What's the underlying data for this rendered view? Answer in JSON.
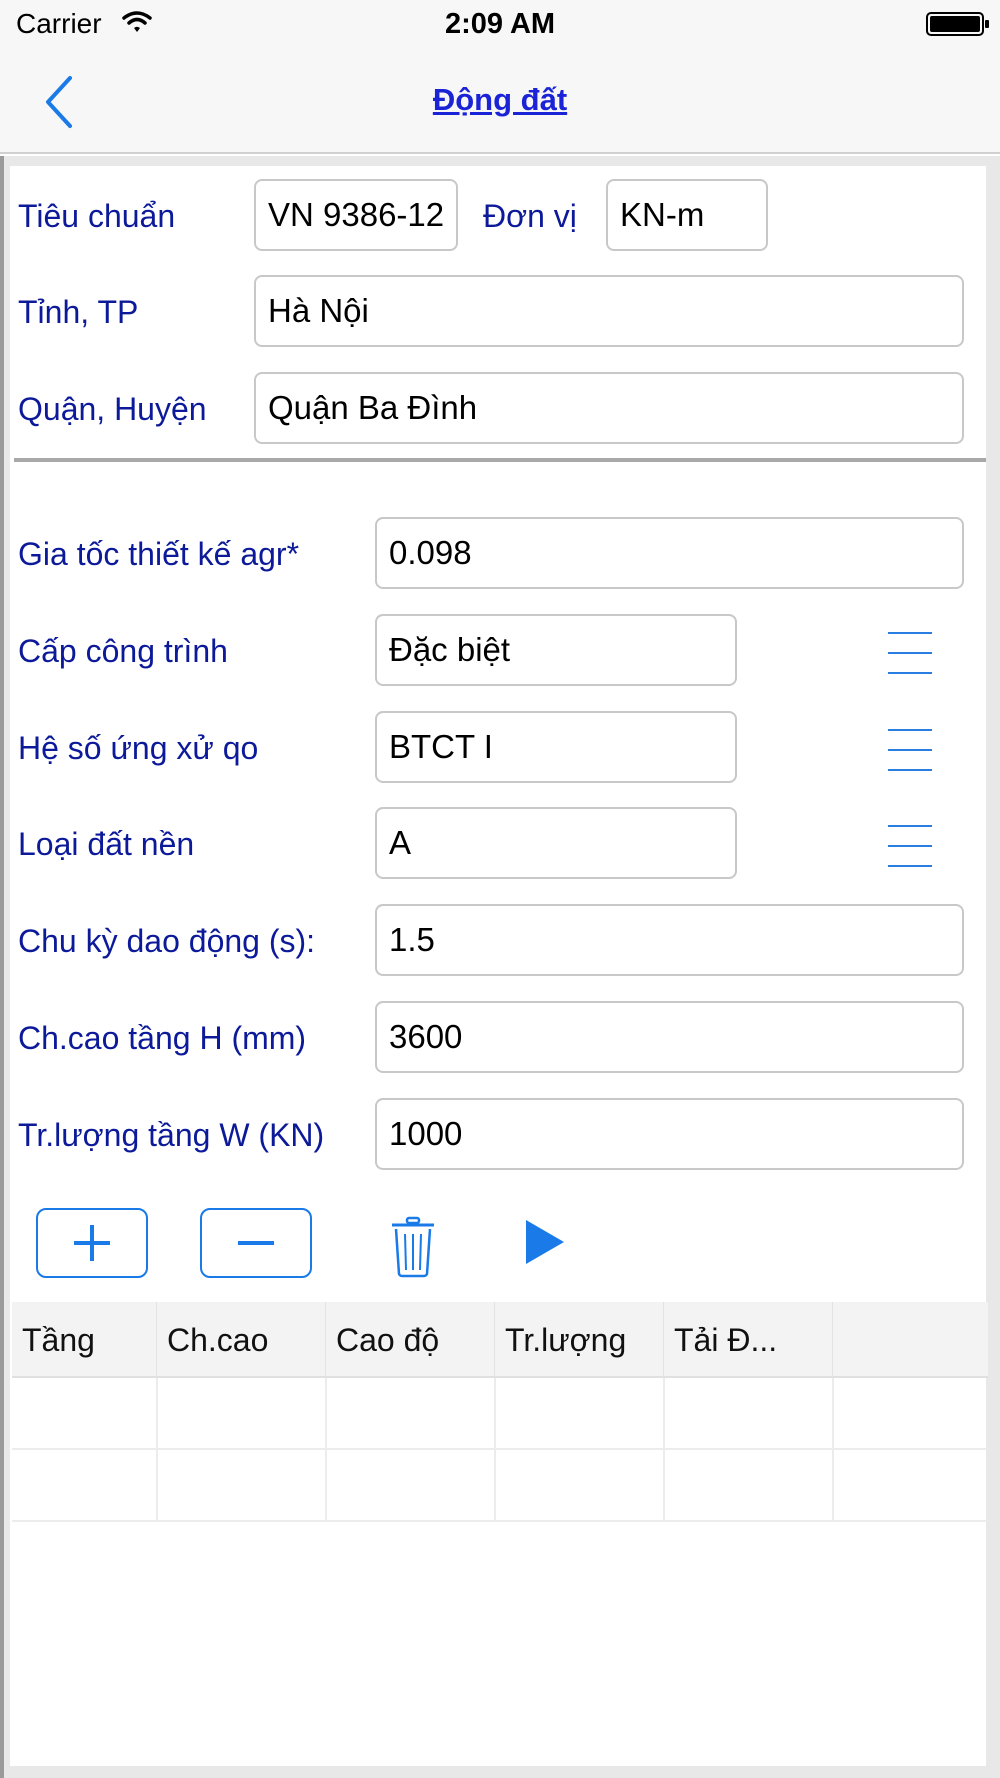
{
  "status_bar": {
    "carrier": "Carrier",
    "time": "2:09 AM"
  },
  "nav": {
    "title": "Động đất",
    "back_icon": "chevron-left-icon"
  },
  "header_form": {
    "standard_label": "Tiêu chuẩn",
    "standard_value": "VN 9386-12",
    "unit_label": "Đơn vị",
    "unit_value": "KN-m",
    "province_label": "Tỉnh, TP",
    "province_value": "Hà Nội",
    "district_label": "Quận, Huyện",
    "district_value": "Quận Ba Đình"
  },
  "params": {
    "agr_label": "Gia tốc thiết kế agr*",
    "agr_value": "0.098",
    "grade_label": "Cấp công trình",
    "grade_value": "Đặc biệt",
    "qo_label": "Hệ số ứng xử qo",
    "qo_value": "BTCT I",
    "soil_label": "Loại đất nền",
    "soil_value": "A",
    "period_label": "Chu kỳ dao động (s):",
    "period_value": "1.5",
    "height_label": "Ch.cao tầng H (mm)",
    "height_value": "3600",
    "weight_label": "Tr.lượng tầng W (KN)",
    "weight_value": "1000"
  },
  "toolbar": {
    "add_icon": "plus-icon",
    "remove_icon": "minus-icon",
    "delete_icon": "trash-icon",
    "run_icon": "play-icon"
  },
  "table": {
    "columns": [
      "Tầng",
      "Ch.cao",
      "Cao độ",
      "Tr.lượng",
      "Tải Đ..."
    ],
    "rows": [
      [
        "",
        "",
        "",
        "",
        "",
        ""
      ],
      [
        "",
        "",
        "",
        "",
        "",
        ""
      ]
    ]
  },
  "colors": {
    "accent": "#1a7ae8",
    "label": "#0c1a9a",
    "title": "#1a23d6"
  }
}
